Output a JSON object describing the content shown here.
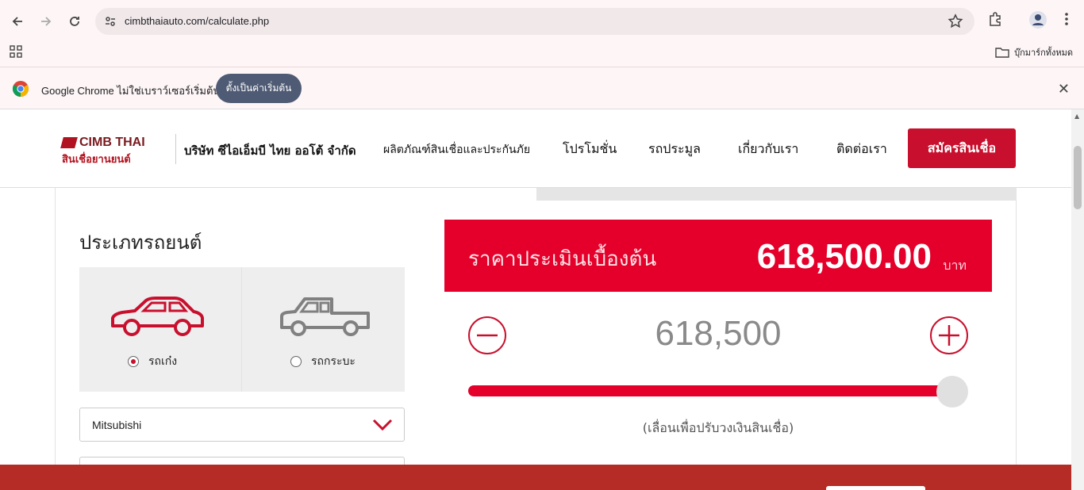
{
  "browser": {
    "url": "cimbthaiauto.com/calculate.php",
    "bookmarks_all_label": "บุ๊กมาร์กทั้งหมด"
  },
  "infobar": {
    "message": "Google Chrome ไม่ใช่เบราว์เซอร์เริ่มต้น",
    "set_default_label": "ตั้งเป็นค่าเริ่มต้น"
  },
  "site": {
    "logo_line1": "CIMB THAI",
    "logo_line2": "สินเชื่อยานยนต์",
    "company_name": "บริษัท ซีไอเอ็มบี ไทย ออโต้ จำกัด",
    "menu": [
      {
        "label": "ผลิตภัณฑ์สินเชื่อและประกันภัย"
      },
      {
        "label": "โปรโมชั่น"
      },
      {
        "label": "รถประมูล"
      },
      {
        "label": "เกี่ยวกับเรา"
      },
      {
        "label": "ติดต่อเรา"
      }
    ],
    "apply_label": "สมัครสินเชื่อ",
    "brand_color": "#e4002b"
  },
  "form": {
    "car_type_title": "ประเภทรถยนต์",
    "car_types": [
      {
        "label": "รถเก๋ง",
        "icon": "sedan-icon",
        "selected": true
      },
      {
        "label": "รถกระบะ",
        "icon": "pickup-truck-icon",
        "selected": false
      }
    ],
    "brand_select_value": "Mitsubishi"
  },
  "estimate": {
    "label": "ราคาประเมินเบื้องต้น",
    "amount": "618,500.00",
    "unit": "บาท",
    "stepper_value": "618,500",
    "slider_hint": "(เลื่อนเพื่อปรับวงเงินสินเชื่อ)",
    "slider_level": 1.0
  }
}
